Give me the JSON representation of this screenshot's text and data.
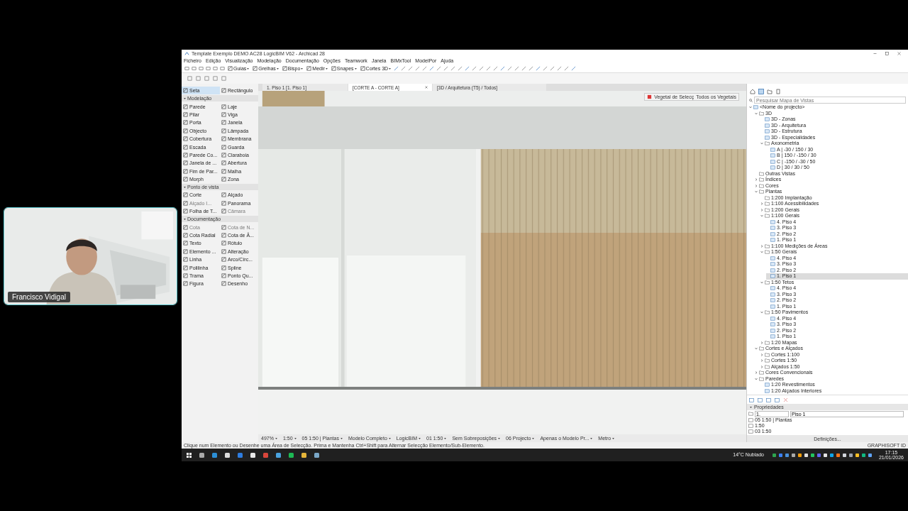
{
  "window": {
    "title": "Template Exemplo DEMO AC28 LogicBIM V62 - Archicad 28"
  },
  "menu": [
    "Ficheiro",
    "Edição",
    "Visualização",
    "Modelação",
    "Documentação",
    "Opções",
    "Teamwork",
    "Janela",
    "BIMxTool",
    "ModelPor",
    "Ajuda"
  ],
  "toolbar": [
    "Guias",
    "Grelhas",
    "Bispo",
    "Medir",
    "Snapes",
    "Cortes 3D"
  ],
  "tabs": [
    {
      "label": "1. Piso 1 [1. Piso 1]",
      "selected": false
    },
    {
      "label": "[CORTE A - CORTE A]",
      "selected": true
    },
    {
      "label": "[3D / Arquitetura (T5) / Todos]",
      "selected": false
    }
  ],
  "toolbox": {
    "top": [
      {
        "label": "Seta",
        "selected": true
      },
      {
        "label": "Rectângulo",
        "selected": false
      }
    ],
    "sections": [
      {
        "title": "Modelação",
        "expanded": true,
        "tools": [
          {
            "label": "Parede",
            "disabled": false
          },
          {
            "label": "Laje",
            "disabled": false
          },
          {
            "label": "Pilar",
            "disabled": false
          },
          {
            "label": "Viga",
            "disabled": false
          },
          {
            "label": "Porta",
            "disabled": false
          },
          {
            "label": "Janela",
            "disabled": false
          },
          {
            "label": "Objecto",
            "disabled": false
          },
          {
            "label": "Lâmpada",
            "disabled": false
          },
          {
            "label": "Cobertura",
            "disabled": false
          },
          {
            "label": "Membrana",
            "disabled": false
          },
          {
            "label": "Escada",
            "disabled": false
          },
          {
            "label": "Guarda",
            "disabled": false
          },
          {
            "label": "Parede Co...",
            "disabled": false
          },
          {
            "label": "Claraboia",
            "disabled": false
          },
          {
            "label": "Janela de ...",
            "disabled": false
          },
          {
            "label": "Abertura",
            "disabled": false
          },
          {
            "label": "Fim de Par...",
            "disabled": false
          },
          {
            "label": "Malha",
            "disabled": false
          },
          {
            "label": "Morph",
            "disabled": false
          },
          {
            "label": "Zona",
            "disabled": false
          }
        ]
      },
      {
        "title": "Ponto de vista",
        "expanded": true,
        "tools": [
          {
            "label": "Corte",
            "disabled": false
          },
          {
            "label": "Alçado",
            "disabled": false
          },
          {
            "label": "Alçado I...",
            "disabled": true
          },
          {
            "label": "Panorama",
            "disabled": false
          },
          {
            "label": "Folha de T...",
            "disabled": false
          },
          {
            "label": "Câmara",
            "disabled": true
          }
        ]
      },
      {
        "title": "Documentação",
        "expanded": true,
        "tools": [
          {
            "label": "Cota",
            "disabled": true
          },
          {
            "label": "Cota de N...",
            "disabled": true
          },
          {
            "label": "Cota Radial",
            "disabled": false
          },
          {
            "label": "Cota de Â...",
            "disabled": false
          },
          {
            "label": "Texto",
            "disabled": false
          },
          {
            "label": "Rótulo",
            "disabled": false
          },
          {
            "label": "Elemento ...",
            "disabled": false
          },
          {
            "label": "Alteração",
            "disabled": false
          },
          {
            "label": "Linha",
            "disabled": false
          },
          {
            "label": "Arco/Círc...",
            "disabled": false
          },
          {
            "label": "Polilinha",
            "disabled": false
          },
          {
            "label": "Spline",
            "disabled": false
          },
          {
            "label": "Trama",
            "disabled": false
          },
          {
            "label": "Ponto Qu...",
            "disabled": false
          },
          {
            "label": "Figura",
            "disabled": false
          },
          {
            "label": "Desenho",
            "disabled": false
          }
        ]
      }
    ]
  },
  "selection_palette": {
    "labels": [
      "Vegetal de Selecç",
      "Todos os Vegetais"
    ]
  },
  "status_bar": {
    "fields": [
      "497%",
      "1:50",
      "05 1:50 | Plantas",
      "Modelo Completo",
      "LogicBIM",
      "01 1:50",
      "Sem Sobreposições",
      "06 Projecto",
      "Apenas o Modelo Pr...",
      "Metro"
    ],
    "hint": "Clique num Elemento ou Desenhe uma Área de Selecção. Prima e Mantenha Ctrl+Shift para Alternar Selecção Elemento/Sub-Elemento.",
    "brand": "GRAPHISOFT ID"
  },
  "navigator": {
    "search_placeholder": "Pesquisar Mapa de Vistas",
    "tree": [
      {
        "label": "<Nome do projecto>",
        "kind": "view",
        "selected": false,
        "expanded": true,
        "children": [
          {
            "label": "3D",
            "kind": "folder",
            "selected": false,
            "expanded": true,
            "children": [
              {
                "label": "3D - Zonas",
                "kind": "view",
                "selected": false
              },
              {
                "label": "3D - Arquitetura",
                "kind": "view",
                "selected": false
              },
              {
                "label": "3D - Estrutura",
                "kind": "view",
                "selected": false
              },
              {
                "label": "3D - Especialidades",
                "kind": "view",
                "selected": false
              },
              {
                "label": "Axonometria",
                "kind": "folder",
                "selected": false,
                "expanded": true,
                "children": [
                  {
                    "label": "A | -30 / 150 / 30",
                    "kind": "view",
                    "selected": false
                  },
                  {
                    "label": "B | 150 / -150 / 30",
                    "kind": "view",
                    "selected": false
                  },
                  {
                    "label": "C | -150 / -30 / 50",
                    "kind": "view",
                    "selected": false
                  },
                  {
                    "label": "D | 30 / 30 / 50",
                    "kind": "view",
                    "selected": false
                  }
                ]
              }
            ]
          },
          {
            "label": "Outras Vistas",
            "kind": "folder",
            "selected": false
          },
          {
            "label": "Índices",
            "kind": "folder",
            "selected": false,
            "expanded": false
          },
          {
            "label": "Cores",
            "kind": "folder",
            "selected": false,
            "expanded": false
          },
          {
            "label": "Plantas",
            "kind": "folder",
            "selected": false,
            "expanded": true,
            "children": [
              {
                "label": "1:200 Implantação",
                "kind": "folder",
                "selected": false
              },
              {
                "label": "1:100 Acessibilidades",
                "kind": "folder",
                "selected": false,
                "expanded": false
              },
              {
                "label": "1:200 Gerais",
                "kind": "folder",
                "selected": false,
                "expanded": false
              },
              {
                "label": "1:100 Gerais",
                "kind": "folder",
                "selected": false,
                "expanded": true,
                "children": [
                  {
                    "label": "4. Piso 4",
                    "kind": "view",
                    "selected": false
                  },
                  {
                    "label": "3. Piso 3",
                    "kind": "view",
                    "selected": false
                  },
                  {
                    "label": "2. Piso 2",
                    "kind": "view",
                    "selected": false
                  },
                  {
                    "label": "1. Piso 1",
                    "kind": "view",
                    "selected": false
                  }
                ]
              },
              {
                "label": "1:100 Medições de Áreas",
                "kind": "folder",
                "selected": false,
                "expanded": false
              },
              {
                "label": "1:50 Gerais",
                "kind": "folder",
                "selected": false,
                "expanded": true,
                "children": [
                  {
                    "label": "4. Piso 4",
                    "kind": "view",
                    "selected": false
                  },
                  {
                    "label": "3. Piso 3",
                    "kind": "view",
                    "selected": false
                  },
                  {
                    "label": "2. Piso 2",
                    "kind": "view",
                    "selected": false
                  },
                  {
                    "label": "1. Piso 1",
                    "kind": "view",
                    "selected": true
                  }
                ]
              },
              {
                "label": "1:50 Tetos",
                "kind": "folder",
                "selected": false,
                "expanded": true,
                "children": [
                  {
                    "label": "4. Piso 4",
                    "kind": "view",
                    "selected": false
                  },
                  {
                    "label": "3. Piso 3",
                    "kind": "view",
                    "selected": false
                  },
                  {
                    "label": "2. Piso 2",
                    "kind": "view",
                    "selected": false
                  },
                  {
                    "label": "1. Piso 1",
                    "kind": "view",
                    "selected": false
                  }
                ]
              },
              {
                "label": "1:50 Pavimentos",
                "kind": "folder",
                "selected": false,
                "expanded": true,
                "children": [
                  {
                    "label": "4. Piso 4",
                    "kind": "view",
                    "selected": false
                  },
                  {
                    "label": "3. Piso 3",
                    "kind": "view",
                    "selected": false
                  },
                  {
                    "label": "2. Piso 2",
                    "kind": "view",
                    "selected": false
                  },
                  {
                    "label": "1. Piso 1",
                    "kind": "view",
                    "selected": false
                  }
                ]
              },
              {
                "label": "1:20 Mapas",
                "kind": "folder",
                "selected": false,
                "expanded": false
              }
            ]
          },
          {
            "label": "Cortes e Alçados",
            "kind": "folder",
            "selected": false,
            "expanded": true,
            "children": [
              {
                "label": "Cortes 1:100",
                "kind": "folder",
                "selected": false,
                "expanded": false
              },
              {
                "label": "Cortes 1:50",
                "kind": "folder",
                "selected": false,
                "expanded": false
              },
              {
                "label": "Alçados 1:50",
                "kind": "folder",
                "selected": false,
                "expanded": false
              }
            ]
          },
          {
            "label": "Cores Convencionais",
            "kind": "folder",
            "selected": false,
            "expanded": false
          },
          {
            "label": "Paredes",
            "kind": "folder",
            "selected": false,
            "expanded": true,
            "children": [
              {
                "label": "1:20 Revestimentos",
                "kind": "view",
                "selected": false
              },
              {
                "label": "1:20 Alçados Interiores",
                "kind": "view",
                "selected": false
              }
            ]
          }
        ]
      }
    ]
  },
  "properties": {
    "title": "Propriedades",
    "expanded": true,
    "id": "1.",
    "name": "Piso 1",
    "rows": [
      "05 1:50 | Plantas",
      "1:50",
      "03 1:50"
    ],
    "button": "Definições..."
  },
  "taskbar": {
    "weather": "14°C Nublado",
    "time": "17:15",
    "date": "21/01/2026"
  },
  "webcam": {
    "name": "Francisco Vidigal"
  }
}
